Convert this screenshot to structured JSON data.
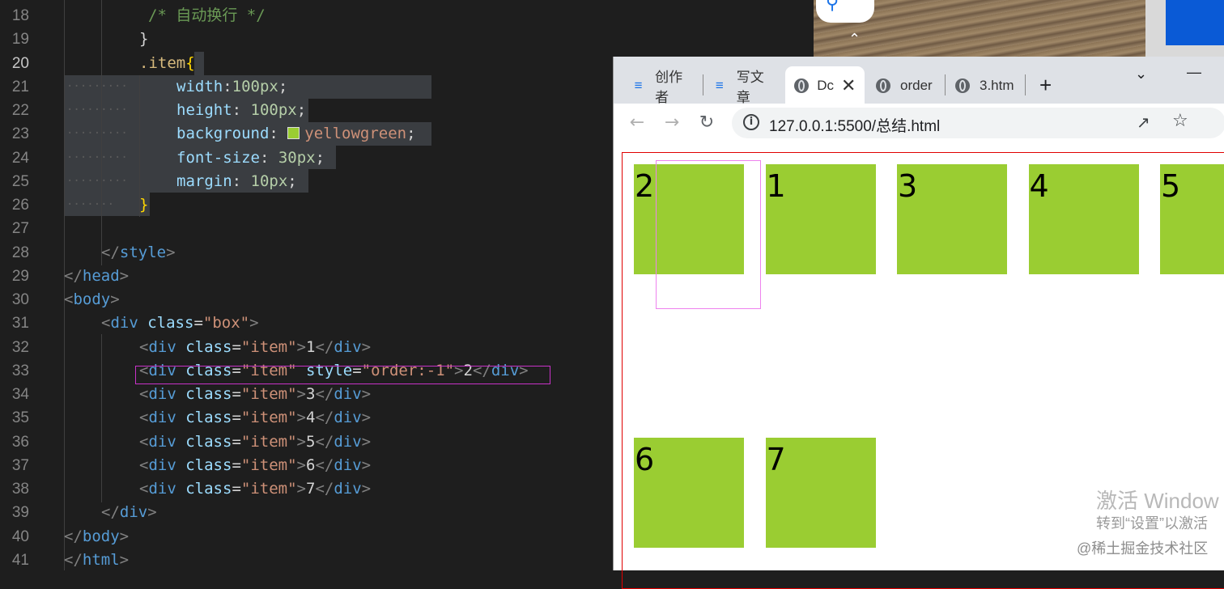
{
  "editor": {
    "lines": [
      {
        "num": "18",
        "segments": [
          {
            "cls": "c-comment",
            "t": "/* 自动换行 */"
          }
        ]
      },
      {
        "num": "19",
        "segments": [
          {
            "cls": "c-punc",
            "t": "}"
          }
        ]
      },
      {
        "num": "20",
        "segments": [
          {
            "cls": "c-sel",
            "t": ".item"
          },
          {
            "cls": "c-brace",
            "t": "{"
          }
        ]
      },
      {
        "num": "21",
        "segments": [
          {
            "cls": "c-prop",
            "t": "width"
          },
          {
            "cls": "c-punc",
            "t": ":"
          },
          {
            "cls": "c-num",
            "t": "100px"
          },
          {
            "cls": "c-punc",
            "t": ";"
          }
        ]
      },
      {
        "num": "22",
        "segments": [
          {
            "cls": "c-prop",
            "t": "height"
          },
          {
            "cls": "c-punc",
            "t": ": "
          },
          {
            "cls": "c-num",
            "t": "100px"
          },
          {
            "cls": "c-punc",
            "t": ";"
          }
        ]
      },
      {
        "num": "23",
        "segments": [
          {
            "cls": "c-prop",
            "t": "background"
          },
          {
            "cls": "c-punc",
            "t": ": "
          },
          {
            "cls": "swatch",
            "t": ""
          },
          {
            "cls": "c-val",
            "t": "yellowgreen"
          },
          {
            "cls": "c-punc",
            "t": ";"
          }
        ]
      },
      {
        "num": "24",
        "segments": [
          {
            "cls": "c-prop",
            "t": "font-size"
          },
          {
            "cls": "c-punc",
            "t": ": "
          },
          {
            "cls": "c-num",
            "t": "30px"
          },
          {
            "cls": "c-punc",
            "t": ";"
          }
        ]
      },
      {
        "num": "25",
        "segments": [
          {
            "cls": "c-prop",
            "t": "margin"
          },
          {
            "cls": "c-punc",
            "t": ": "
          },
          {
            "cls": "c-num",
            "t": "10px"
          },
          {
            "cls": "c-punc",
            "t": ";"
          }
        ]
      },
      {
        "num": "26",
        "segments": [
          {
            "cls": "c-brace",
            "t": "}"
          }
        ]
      },
      {
        "num": "27",
        "segments": []
      },
      {
        "num": "28",
        "segments": [
          {
            "cls": "c-gray",
            "t": "</"
          },
          {
            "cls": "c-tag",
            "t": "style"
          },
          {
            "cls": "c-gray",
            "t": ">"
          }
        ]
      },
      {
        "num": "29",
        "segments": [
          {
            "cls": "c-gray",
            "t": "</"
          },
          {
            "cls": "c-tag",
            "t": "head"
          },
          {
            "cls": "c-gray",
            "t": ">"
          }
        ]
      },
      {
        "num": "30",
        "segments": [
          {
            "cls": "c-gray",
            "t": "<"
          },
          {
            "cls": "c-tag",
            "t": "body"
          },
          {
            "cls": "c-gray",
            "t": ">"
          }
        ]
      },
      {
        "num": "31",
        "segments": [
          {
            "cls": "c-gray",
            "t": "<"
          },
          {
            "cls": "c-tag",
            "t": "div"
          },
          {
            "cls": "c-text",
            "t": " "
          },
          {
            "cls": "c-attr",
            "t": "class"
          },
          {
            "cls": "c-text",
            "t": "="
          },
          {
            "cls": "c-str",
            "t": "\"box\""
          },
          {
            "cls": "c-gray",
            "t": ">"
          }
        ]
      },
      {
        "num": "32",
        "segments": [
          {
            "cls": "c-gray",
            "t": "<"
          },
          {
            "cls": "c-tag",
            "t": "div"
          },
          {
            "cls": "c-text",
            "t": " "
          },
          {
            "cls": "c-attr",
            "t": "class"
          },
          {
            "cls": "c-text",
            "t": "="
          },
          {
            "cls": "c-str",
            "t": "\"item\""
          },
          {
            "cls": "c-gray",
            "t": ">"
          },
          {
            "cls": "c-text",
            "t": "1"
          },
          {
            "cls": "c-gray",
            "t": "</"
          },
          {
            "cls": "c-tag",
            "t": "div"
          },
          {
            "cls": "c-gray",
            "t": ">"
          }
        ]
      },
      {
        "num": "33",
        "segments": [
          {
            "cls": "c-gray",
            "t": "<"
          },
          {
            "cls": "c-tag",
            "t": "div"
          },
          {
            "cls": "c-text",
            "t": " "
          },
          {
            "cls": "c-attr",
            "t": "class"
          },
          {
            "cls": "c-text",
            "t": "="
          },
          {
            "cls": "c-str",
            "t": "\"item\""
          },
          {
            "cls": "c-text",
            "t": " "
          },
          {
            "cls": "c-attr",
            "t": "style"
          },
          {
            "cls": "c-text",
            "t": "="
          },
          {
            "cls": "c-str",
            "t": "\"order:-1\""
          },
          {
            "cls": "c-gray",
            "t": ">"
          },
          {
            "cls": "c-text",
            "t": "2"
          },
          {
            "cls": "c-gray",
            "t": "</"
          },
          {
            "cls": "c-tag",
            "t": "div"
          },
          {
            "cls": "c-gray",
            "t": ">"
          }
        ]
      },
      {
        "num": "34",
        "segments": [
          {
            "cls": "c-gray",
            "t": "<"
          },
          {
            "cls": "c-tag",
            "t": "div"
          },
          {
            "cls": "c-text",
            "t": " "
          },
          {
            "cls": "c-attr",
            "t": "class"
          },
          {
            "cls": "c-text",
            "t": "="
          },
          {
            "cls": "c-str",
            "t": "\"item\""
          },
          {
            "cls": "c-gray",
            "t": ">"
          },
          {
            "cls": "c-text",
            "t": "3"
          },
          {
            "cls": "c-gray",
            "t": "</"
          },
          {
            "cls": "c-tag",
            "t": "div"
          },
          {
            "cls": "c-gray",
            "t": ">"
          }
        ]
      },
      {
        "num": "35",
        "segments": [
          {
            "cls": "c-gray",
            "t": "<"
          },
          {
            "cls": "c-tag",
            "t": "div"
          },
          {
            "cls": "c-text",
            "t": " "
          },
          {
            "cls": "c-attr",
            "t": "class"
          },
          {
            "cls": "c-text",
            "t": "="
          },
          {
            "cls": "c-str",
            "t": "\"item\""
          },
          {
            "cls": "c-gray",
            "t": ">"
          },
          {
            "cls": "c-text",
            "t": "4"
          },
          {
            "cls": "c-gray",
            "t": "</"
          },
          {
            "cls": "c-tag",
            "t": "div"
          },
          {
            "cls": "c-gray",
            "t": ">"
          }
        ]
      },
      {
        "num": "36",
        "segments": [
          {
            "cls": "c-gray",
            "t": "<"
          },
          {
            "cls": "c-tag",
            "t": "div"
          },
          {
            "cls": "c-text",
            "t": " "
          },
          {
            "cls": "c-attr",
            "t": "class"
          },
          {
            "cls": "c-text",
            "t": "="
          },
          {
            "cls": "c-str",
            "t": "\"item\""
          },
          {
            "cls": "c-gray",
            "t": ">"
          },
          {
            "cls": "c-text",
            "t": "5"
          },
          {
            "cls": "c-gray",
            "t": "</"
          },
          {
            "cls": "c-tag",
            "t": "div"
          },
          {
            "cls": "c-gray",
            "t": ">"
          }
        ]
      },
      {
        "num": "37",
        "segments": [
          {
            "cls": "c-gray",
            "t": "<"
          },
          {
            "cls": "c-tag",
            "t": "div"
          },
          {
            "cls": "c-text",
            "t": " "
          },
          {
            "cls": "c-attr",
            "t": "class"
          },
          {
            "cls": "c-text",
            "t": "="
          },
          {
            "cls": "c-str",
            "t": "\"item\""
          },
          {
            "cls": "c-gray",
            "t": ">"
          },
          {
            "cls": "c-text",
            "t": "6"
          },
          {
            "cls": "c-gray",
            "t": "</"
          },
          {
            "cls": "c-tag",
            "t": "div"
          },
          {
            "cls": "c-gray",
            "t": ">"
          }
        ]
      },
      {
        "num": "38",
        "segments": [
          {
            "cls": "c-gray",
            "t": "<"
          },
          {
            "cls": "c-tag",
            "t": "div"
          },
          {
            "cls": "c-text",
            "t": " "
          },
          {
            "cls": "c-attr",
            "t": "class"
          },
          {
            "cls": "c-text",
            "t": "="
          },
          {
            "cls": "c-str",
            "t": "\"item\""
          },
          {
            "cls": "c-gray",
            "t": ">"
          },
          {
            "cls": "c-text",
            "t": "7"
          },
          {
            "cls": "c-gray",
            "t": "</"
          },
          {
            "cls": "c-tag",
            "t": "div"
          },
          {
            "cls": "c-gray",
            "t": ">"
          }
        ]
      },
      {
        "num": "39",
        "segments": [
          {
            "cls": "c-gray",
            "t": "</"
          },
          {
            "cls": "c-tag",
            "t": "div"
          },
          {
            "cls": "c-gray",
            "t": ">"
          }
        ]
      },
      {
        "num": "40",
        "segments": [
          {
            "cls": "c-gray",
            "t": "</"
          },
          {
            "cls": "c-tag",
            "t": "body"
          },
          {
            "cls": "c-gray",
            "t": ">"
          }
        ]
      },
      {
        "num": "41",
        "segments": [
          {
            "cls": "c-gray",
            "t": "</"
          },
          {
            "cls": "c-tag",
            "t": "html"
          },
          {
            "cls": "c-gray",
            "t": ">"
          }
        ]
      }
    ]
  },
  "browser": {
    "tabs": [
      {
        "label": "创作者",
        "icon": "juejin-icon"
      },
      {
        "label": "写文章",
        "icon": "juejin-icon"
      },
      {
        "label": "Dc",
        "icon": "globe-icon"
      },
      {
        "label": "order",
        "icon": "globe-icon"
      },
      {
        "label": "3.htm",
        "icon": "globe-icon"
      }
    ],
    "url": "127.0.0.1:5500/总结.html",
    "items": [
      "2",
      "1",
      "3",
      "4",
      "5",
      "6",
      "7"
    ]
  },
  "overlay": {
    "watermark_line1": "激活 Window",
    "watermark_line2": "转到“设置”以激活",
    "credit": "@稀土掘金技术社区"
  },
  "colors": {
    "item_bg": "#9acd32",
    "box_border": "#e00000",
    "highlight": "#c832c8"
  }
}
